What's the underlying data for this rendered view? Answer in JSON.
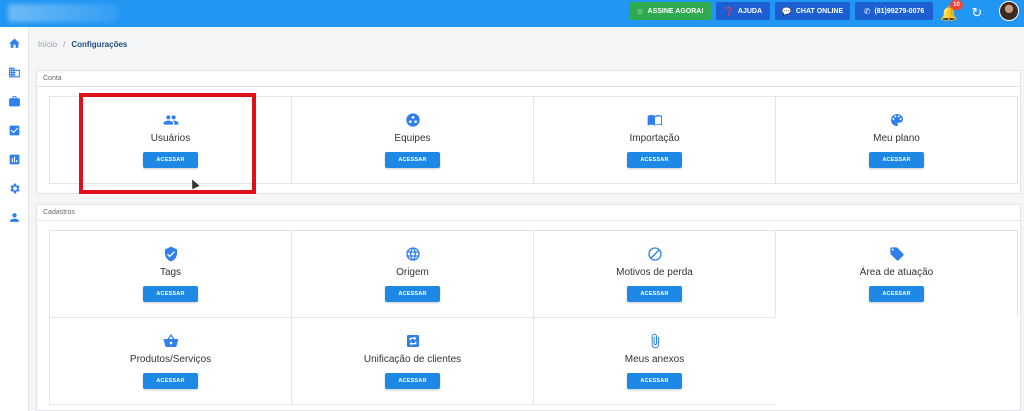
{
  "topbar": {
    "assine_label": "ASSINE AGORA!",
    "ajuda_label": "AJUDA",
    "chat_label": "CHAT ONLINE",
    "phone_label": "(81)99279-0076",
    "notification_count": "10",
    "accent_color": "#2196f3",
    "icons": [
      "star-icon",
      "help-icon",
      "chat-icon",
      "whatsapp-icon",
      "bell-icon",
      "history-icon"
    ]
  },
  "sidebar": {
    "items": [
      {
        "icon": "home-icon"
      },
      {
        "icon": "building-icon"
      },
      {
        "icon": "briefcase-icon"
      },
      {
        "icon": "check-icon"
      },
      {
        "icon": "chart-icon"
      },
      {
        "icon": "gear-icon"
      },
      {
        "icon": "user-icon"
      }
    ]
  },
  "breadcrumb": {
    "home": "Início",
    "separator": "/",
    "current": "Configurações"
  },
  "conta": {
    "title": "Conta",
    "cards": [
      {
        "label": "Usuários",
        "button": "ACESSAR",
        "icon": "users-icon"
      },
      {
        "label": "Equipes",
        "button": "ACESSAR",
        "icon": "team-icon"
      },
      {
        "label": "Importação",
        "button": "ACESSAR",
        "icon": "book-icon"
      },
      {
        "label": "Meu plano",
        "button": "ACESSAR",
        "icon": "palette-icon"
      }
    ]
  },
  "cadastros": {
    "title": "Cadastros",
    "cards": [
      {
        "label": "Tags",
        "button": "ACESSAR",
        "icon": "shield-check-icon"
      },
      {
        "label": "Origem",
        "button": "ACESSAR",
        "icon": "globe-icon"
      },
      {
        "label": "Motivos de perda",
        "button": "ACESSAR",
        "icon": "block-icon"
      },
      {
        "label": "Área de atuação",
        "button": "ACESSAR",
        "icon": "tag-icon"
      },
      {
        "label": "Produtos/Serviços",
        "button": "ACESSAR",
        "icon": "basket-icon"
      },
      {
        "label": "Unificação de clientes",
        "button": "ACESSAR",
        "icon": "merge-icon"
      },
      {
        "label": "Meus anexos",
        "button": "ACESSAR",
        "icon": "paperclip-icon"
      }
    ]
  }
}
